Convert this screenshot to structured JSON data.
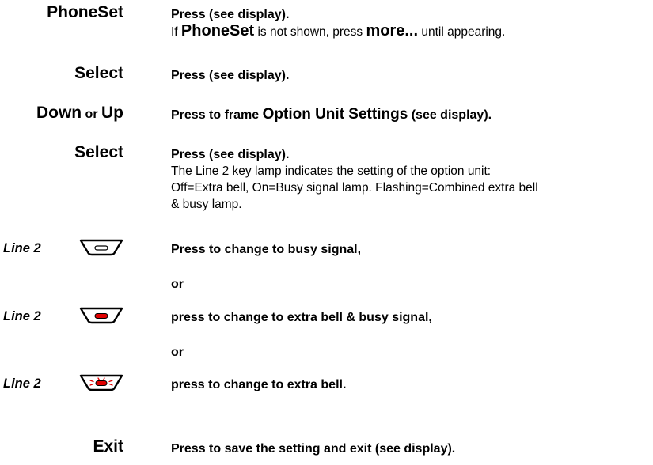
{
  "steps": {
    "phoneset": {
      "key": "PhoneSet",
      "instruction": "Press (see display).",
      "note_prefix": "If ",
      "note_key": "PhoneSet",
      "note_middle": " is not shown, press ",
      "note_more": "more...",
      "note_suffix": " until appearing."
    },
    "select1": {
      "key": "Select",
      "instruction": "Press (see display)."
    },
    "downup": {
      "key_down": "Down",
      "key_or": " or ",
      "key_up": "Up",
      "instruction_prefix": "Press to frame ",
      "instruction_menu": "Option Unit Settings",
      "instruction_suffix": " (see display)."
    },
    "select2": {
      "key": "Select",
      "instruction": "Press (see display).",
      "note_line1": "The Line 2 key lamp indicates the setting of the option unit:",
      "note_line2": "Off=Extra bell, On=Busy signal lamp. Flashing=Combined extra bell",
      "note_line3": "& busy lamp."
    },
    "line_off": {
      "label": "Line 2",
      "icon": "key-lamp-off-icon",
      "instruction": "Press to change to busy signal,"
    },
    "or1": "or",
    "line_on": {
      "label": "Line 2",
      "icon": "key-lamp-on-icon",
      "instruction": "press to change to extra bell & busy signal,"
    },
    "or2": "or",
    "line_flash": {
      "label": "Line 2",
      "icon": "key-lamp-flashing-icon",
      "instruction": "press to change to extra bell."
    },
    "exit": {
      "key": "Exit",
      "instruction": "Press to save the setting and exit (see display)."
    }
  },
  "colors": {
    "text": "#000000",
    "lamp_red": "#e00000"
  }
}
